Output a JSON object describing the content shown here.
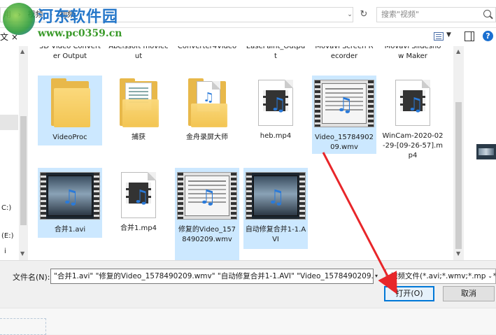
{
  "address_bar": {
    "path_crumbs": [
      "用",
      "›",
      "视频",
      "›",
      "视频"
    ],
    "dropdown_glyph": "⌄",
    "refresh_glyph": "↻"
  },
  "search": {
    "placeholder": "搜索\"视频\""
  },
  "watermark": {
    "site_name": "河东软件园",
    "url": "www.pc0359.cn"
  },
  "toolbar": {
    "new_label": "文 ×"
  },
  "nav": {
    "items": [
      {
        "label": "C:)"
      },
      {
        "label": "(E:)"
      },
      {
        "label": "i"
      }
    ]
  },
  "files": [
    {
      "label": "3D Video Converter Output",
      "kind": "folder",
      "selected": false
    },
    {
      "label": "Abelssoft moviecut",
      "kind": "folder",
      "selected": false
    },
    {
      "label": "Converter4Video",
      "kind": "folder",
      "selected": false
    },
    {
      "label": "EasePaint_Output",
      "kind": "folder",
      "selected": false
    },
    {
      "label": "Movavi Screen Recorder",
      "kind": "folder",
      "selected": false
    },
    {
      "label": "Movavi Slideshow Maker",
      "kind": "folder",
      "selected": false
    },
    {
      "label": "VideoProc",
      "kind": "folder",
      "selected": true
    },
    {
      "label": "捕获",
      "kind": "folder-doc",
      "selected": false
    },
    {
      "label": "金舟录屏大师",
      "kind": "folder-media",
      "selected": false
    },
    {
      "label": "heb.mp4",
      "kind": "mp4",
      "selected": false
    },
    {
      "label": "Video_1578490209.wmv",
      "kind": "video-screen",
      "selected": true
    },
    {
      "label": "WinCam-2020-02-29-[09-26-57].mp4",
      "kind": "mp4",
      "selected": false
    },
    {
      "label": "合并1.avi",
      "kind": "video-dark",
      "selected": true
    },
    {
      "label": "合并1.mp4",
      "kind": "mp4",
      "selected": false
    },
    {
      "label": "修复的Video_1578490209.wmv",
      "kind": "video-screen",
      "selected": true
    },
    {
      "label": "自动修复合并1-1.AVI",
      "kind": "video-dark",
      "selected": true
    }
  ],
  "bottom": {
    "filename_label": "文件名(N):",
    "filename_value": "\"合并1.avi\" \"修复的Video_1578490209.wmv\" \"自动修复合并1-1.AVI\" \"Video_1578490209.wr",
    "filter_value": "视频文件(*.avi;*.wmv;*.mp4;*.r",
    "open_label": "打开(O)",
    "cancel_label": "取消"
  },
  "colors": {
    "selection": "#cce8ff",
    "accent": "#0078d7",
    "arrow": "#e8262a"
  },
  "icons": {
    "search": "search-icon",
    "view": "view-menu-icon",
    "pane": "preview-pane-icon",
    "help": "help-icon",
    "refresh": "refresh-icon"
  }
}
